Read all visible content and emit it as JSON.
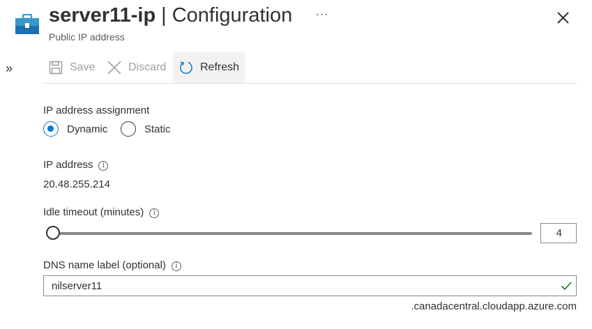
{
  "header": {
    "resource_name": "server11-ip",
    "separator": "|",
    "section": "Configuration",
    "subtitle": "Public IP address",
    "more_label": "···",
    "expand_label": "»"
  },
  "toolbar": {
    "save_label": "Save",
    "discard_label": "Discard",
    "refresh_label": "Refresh"
  },
  "form": {
    "assignment": {
      "label": "IP address assignment",
      "options": [
        {
          "label": "Dynamic",
          "checked": true
        },
        {
          "label": "Static",
          "checked": false
        }
      ]
    },
    "ip": {
      "label": "IP address",
      "value": "20.48.255.214"
    },
    "idle_timeout": {
      "label": "Idle timeout (minutes)",
      "value": "4",
      "fraction": 0.0
    },
    "dns": {
      "label": "DNS name label (optional)",
      "value": "nilserver11",
      "suffix": ".canadacentral.cloudapp.azure.com"
    }
  },
  "colors": {
    "accent": "#0078d4",
    "valid": "#107c10",
    "text": "#323130",
    "muted": "#605e5c",
    "disabled": "#a19f9d"
  },
  "icons": {
    "resource": "public-ip-toolbox-icon",
    "save": "save-icon",
    "discard": "close-icon",
    "refresh": "refresh-icon",
    "info": "info-icon",
    "valid": "checkmark-icon"
  }
}
